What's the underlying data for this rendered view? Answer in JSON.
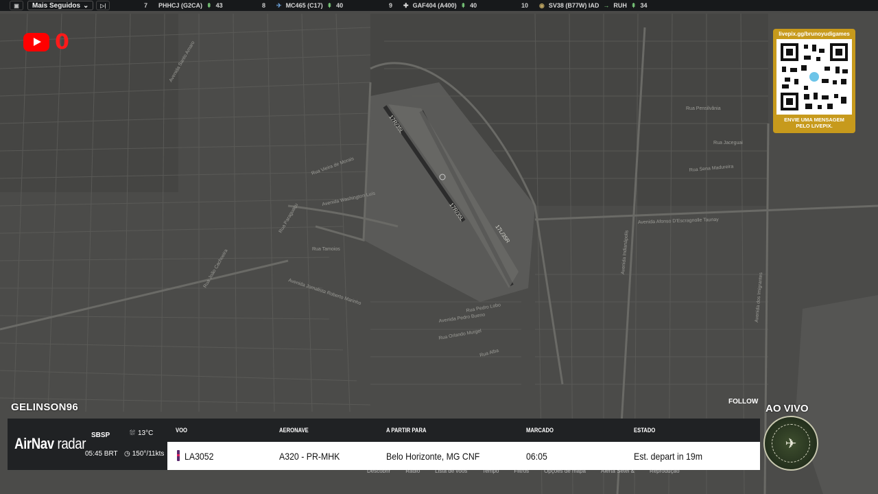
{
  "topbar": {
    "follow_select": "Mais Seguidos",
    "flights": [
      {
        "rank": "7",
        "callsign": "PHHCJ (G2CA)",
        "altitude": "43",
        "icon": "bird-icon"
      },
      {
        "rank": "8",
        "callsign": "MC465 (C17)",
        "altitude": "40",
        "icon": "plane-icon"
      },
      {
        "rank": "9",
        "callsign": "GAF404 (A400)",
        "altitude": "40",
        "icon": "cross-icon"
      },
      {
        "rank": "10",
        "callsign": "SV38 (B77W) IAD",
        "dest": "RUH",
        "altitude": "34",
        "icon": "emblem-icon"
      }
    ]
  },
  "youtube": {
    "count": "0"
  },
  "livepix": {
    "url": "livepix.gg/brunoyudigames",
    "message_line1": "ENVIE UMA MENSAGEM",
    "message_line2": "PELO LIVEPIX."
  },
  "map_labels": [
    "Avenida Washington Luís",
    "Rua Tamoios",
    "Avenida Afonso D'Escragnolle Taunay",
    "Avenida Jornalista Roberto Marinho",
    "Rua Orlando Murgel",
    "Avenida Pedro Bueno",
    "Rua Vieira de Morais",
    "Rua Paraguaçu",
    "Avenida dos Imigrantes",
    "Avenida Indianápolis",
    "Rua Sena Madureira",
    "Rua Jaceguai",
    "Rua Alba",
    "Rua Pedro Lobo",
    "Avenida Santo Amaro",
    "Rua João Cachoeira",
    "Rua Pensilvânia",
    "17R/35L",
    "17L/35R",
    "17R/35L"
  ],
  "user": {
    "name": "GELINSON96",
    "follow_label": "FOLLOW"
  },
  "live": {
    "label": "AO VIVO"
  },
  "airnav": {
    "brand_a": "AirNav",
    "brand_b": "radar",
    "airport": "SBSP",
    "time": "05:45 BRT",
    "temperature": "13°C",
    "wind": "150°/11kts",
    "headers": {
      "flight": "VOO",
      "aircraft": "AERONAVE",
      "from_to": "A PARTIR PARA",
      "scheduled": "MARCADO",
      "status": "ESTADO"
    },
    "row": {
      "flight": "LA3052",
      "aircraft": "A320 - PR-MHK",
      "from_to": "Belo Horizonte, MG CNF",
      "scheduled": "06:05",
      "status": "Est. depart in 19m"
    }
  },
  "underbar": [
    "Descobrir",
    "Rádio",
    "Lista de voos",
    "Tempo",
    "Filtros",
    "Opções de mapa",
    "Alerta Setei &",
    "Reprodução"
  ],
  "colors": {
    "map_bg": "#4a4a48",
    "road": "#5a5a57",
    "qr_gold": "#c79a1c",
    "youtube": "#ff0000"
  }
}
